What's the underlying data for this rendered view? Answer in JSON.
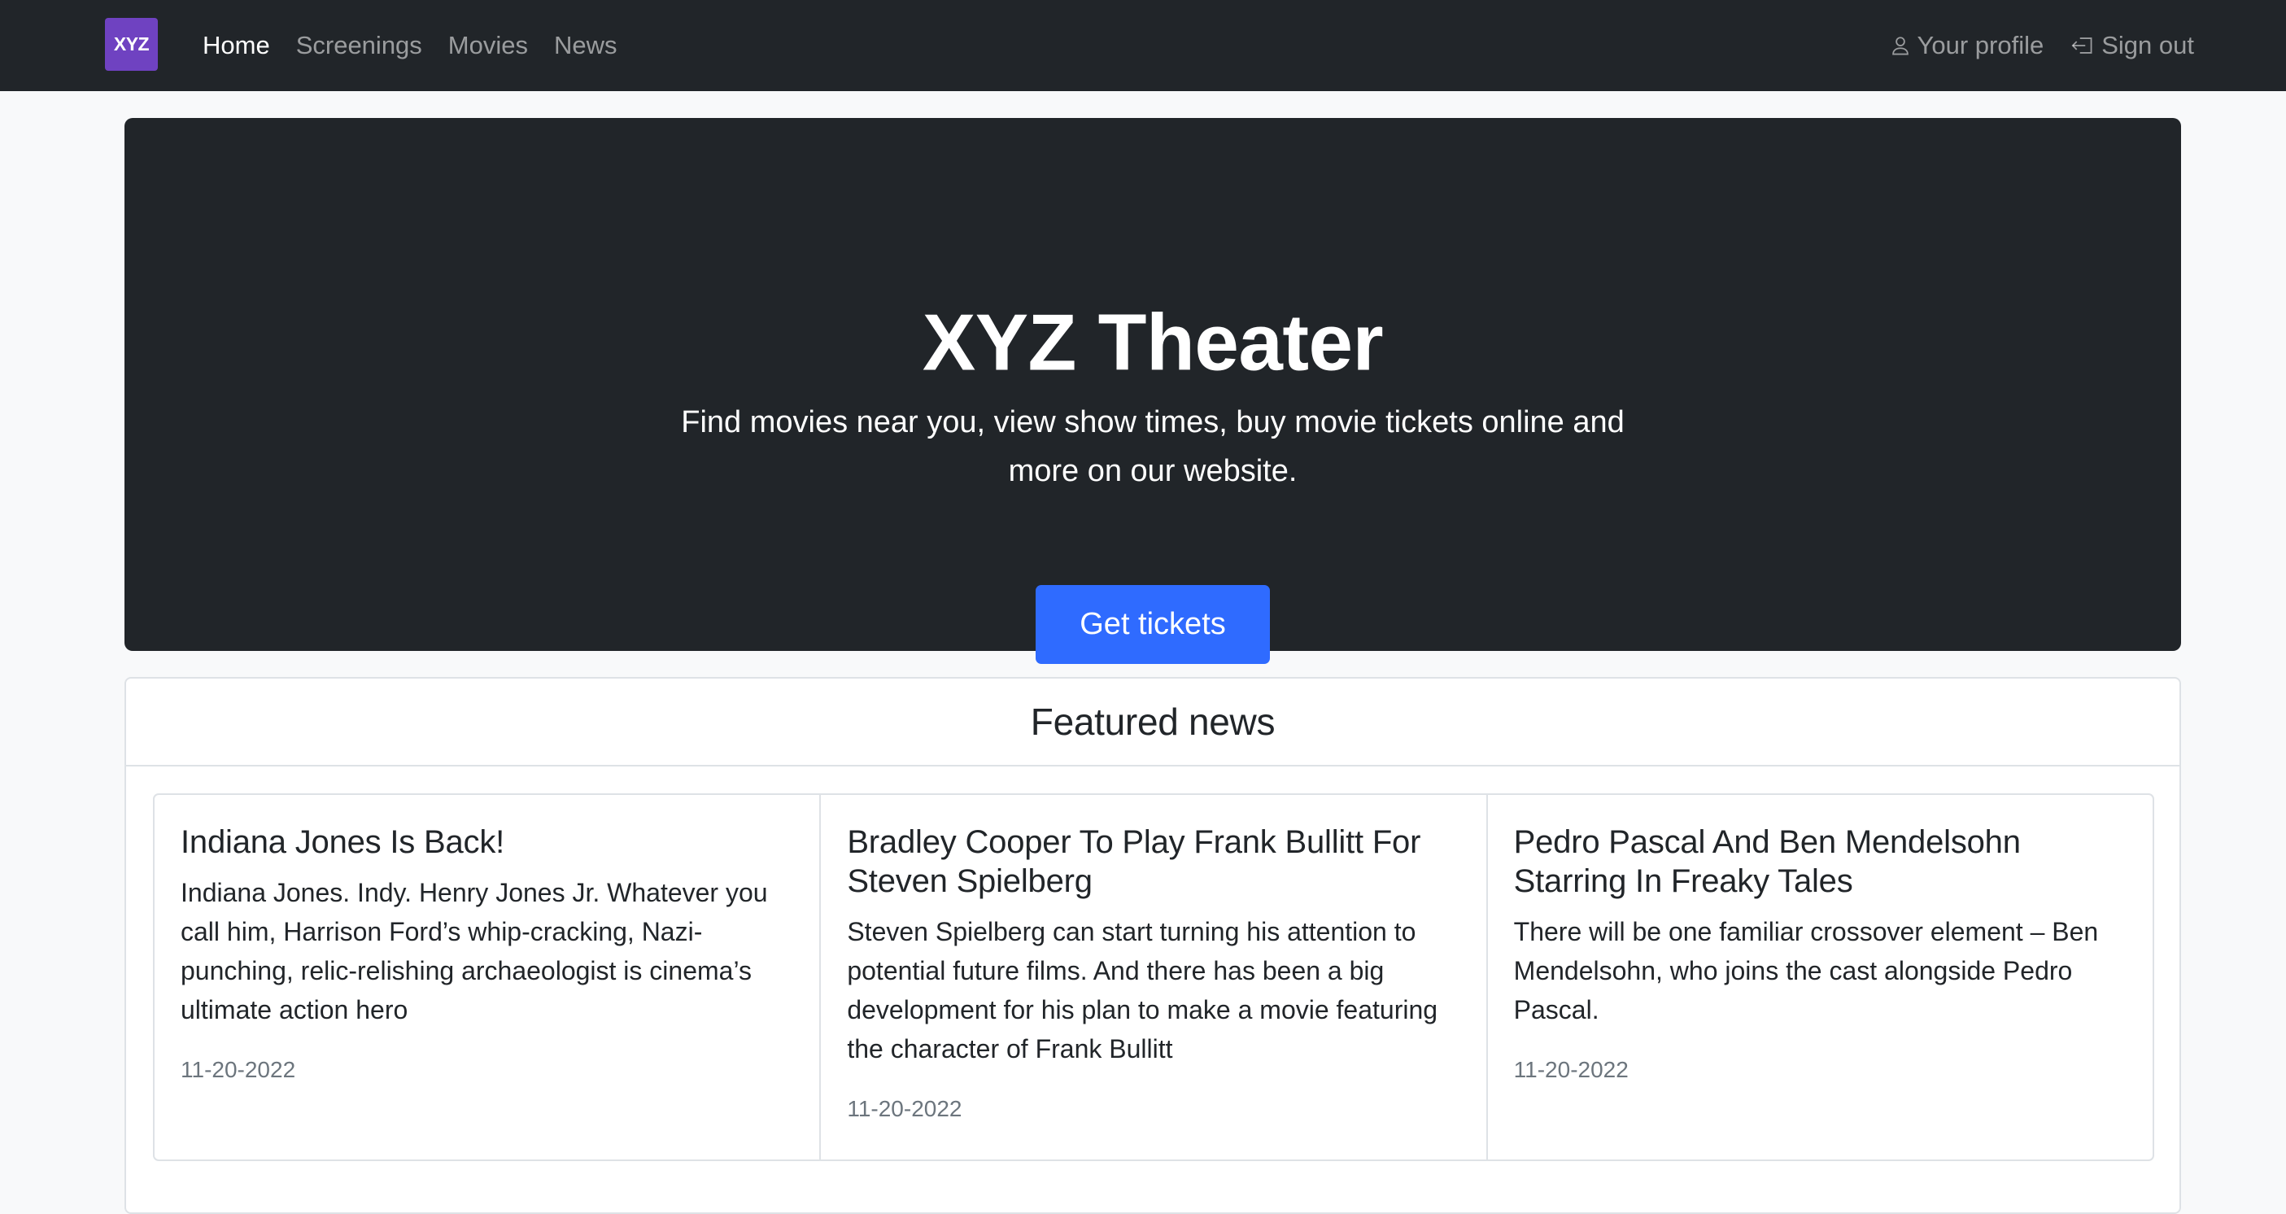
{
  "navbar": {
    "brand": "XYZ",
    "links": [
      {
        "label": "Home",
        "active": true
      },
      {
        "label": "Screenings",
        "active": false
      },
      {
        "label": "Movies",
        "active": false
      },
      {
        "label": "News",
        "active": false
      }
    ],
    "profile_label": "Your profile",
    "profile_icon": "user-icon",
    "signout_label": "Sign out",
    "signout_icon": "sign-out-icon"
  },
  "hero": {
    "title": "XYZ Theater",
    "subtitle": "Find movies near you, view show times, buy movie tickets online and more on our website.",
    "button_label": "Get tickets"
  },
  "news": {
    "heading": "Featured news",
    "items": [
      {
        "title": "Indiana Jones Is Back!",
        "text": "Indiana Jones. Indy. Henry Jones Jr. Whatever you call him, Harrison Ford’s whip-cracking, Nazi-punching, relic-relishing archaeologist is cinema’s ultimate action hero",
        "date": "11-20-2022"
      },
      {
        "title": "Bradley Cooper To Play Frank Bullitt For Steven Spielberg",
        "text": "Steven Spielberg can start turning his attention to potential future films. And there has been a big development for his plan to make a movie featuring the character of Frank Bullitt",
        "date": "11-20-2022"
      },
      {
        "title": "Pedro Pascal And Ben Mendelsohn Starring In Freaky Tales",
        "text": "There will be one familiar crossover element – Ben Mendelsohn, who joins the cast alongside Pedro Pascal.",
        "date": "11-20-2022"
      }
    ]
  },
  "colors": {
    "navbar_bg": "#212529",
    "brand_bg": "#6f42c1",
    "hero_bg": "#212529",
    "primary_button": "#2f6bff",
    "page_bg": "#f8f9fa"
  }
}
